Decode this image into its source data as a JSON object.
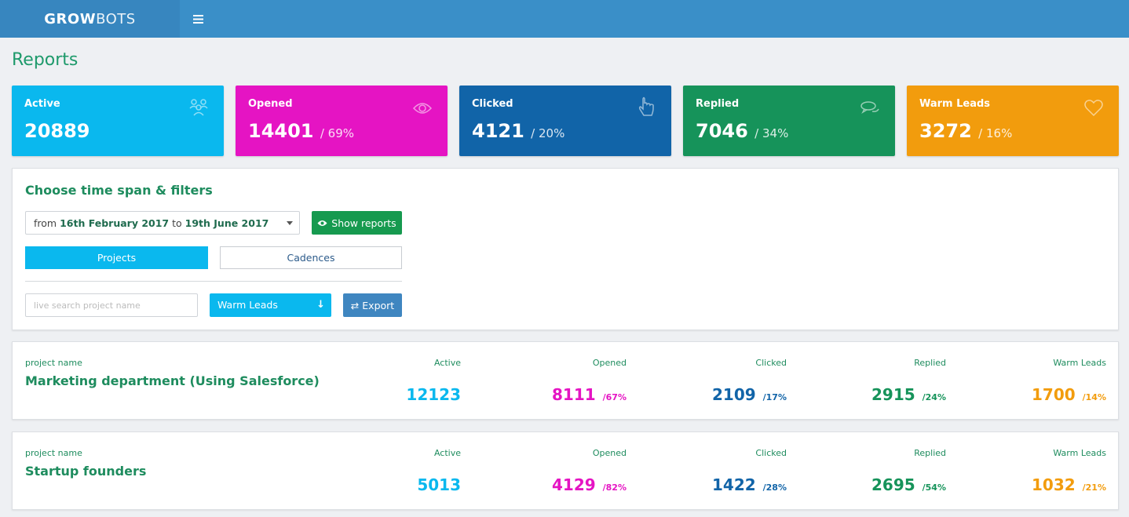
{
  "app": {
    "brand_bold": "GROW",
    "brand_light": "BOTS",
    "menu_icon": "hamburger-icon"
  },
  "page": {
    "title": "Reports"
  },
  "colors": {
    "active": "#0ab8ee",
    "opened": "#e514c3",
    "clicked": "#1164a8",
    "replied": "#16935a",
    "warm": "#f29c0d"
  },
  "cards": [
    {
      "label": "Active",
      "value": "20889",
      "pct": "",
      "icon": "people-icon"
    },
    {
      "label": "Opened",
      "value": "14401",
      "pct": "/ 69%",
      "icon": "eye-icon"
    },
    {
      "label": "Clicked",
      "value": "4121",
      "pct": "/ 20%",
      "icon": "pointer-hand-icon"
    },
    {
      "label": "Replied",
      "value": "7046",
      "pct": "/ 34%",
      "icon": "chat-bubbles-icon"
    },
    {
      "label": "Warm Leads",
      "value": "3272",
      "pct": "/ 16%",
      "icon": "heart-icon"
    }
  ],
  "filters": {
    "heading": "Choose time span & filters",
    "range_from_word": "from",
    "range_start": "16th February 2017",
    "range_to_word": "to",
    "range_end": "19th June 2017",
    "show_reports": "Show reports",
    "tab_projects": "Projects",
    "tab_cadences": "Cadences",
    "search_placeholder": "live search project name",
    "sort_value": "Warm Leads",
    "export": "Export"
  },
  "columns": {
    "project": "project name",
    "active": "Active",
    "opened": "Opened",
    "clicked": "Clicked",
    "replied": "Replied",
    "warm": "Warm Leads"
  },
  "projects": [
    {
      "name": "Marketing department (Using Salesforce)",
      "active": "12123",
      "opened": "8111",
      "opened_pct": "/67%",
      "clicked": "2109",
      "clicked_pct": "/17%",
      "replied": "2915",
      "replied_pct": "/24%",
      "warm": "1700",
      "warm_pct": "/14%"
    },
    {
      "name": "Startup founders",
      "active": "5013",
      "opened": "4129",
      "opened_pct": "/82%",
      "clicked": "1422",
      "clicked_pct": "/28%",
      "replied": "2695",
      "replied_pct": "/54%",
      "warm": "1032",
      "warm_pct": "/21%"
    }
  ]
}
